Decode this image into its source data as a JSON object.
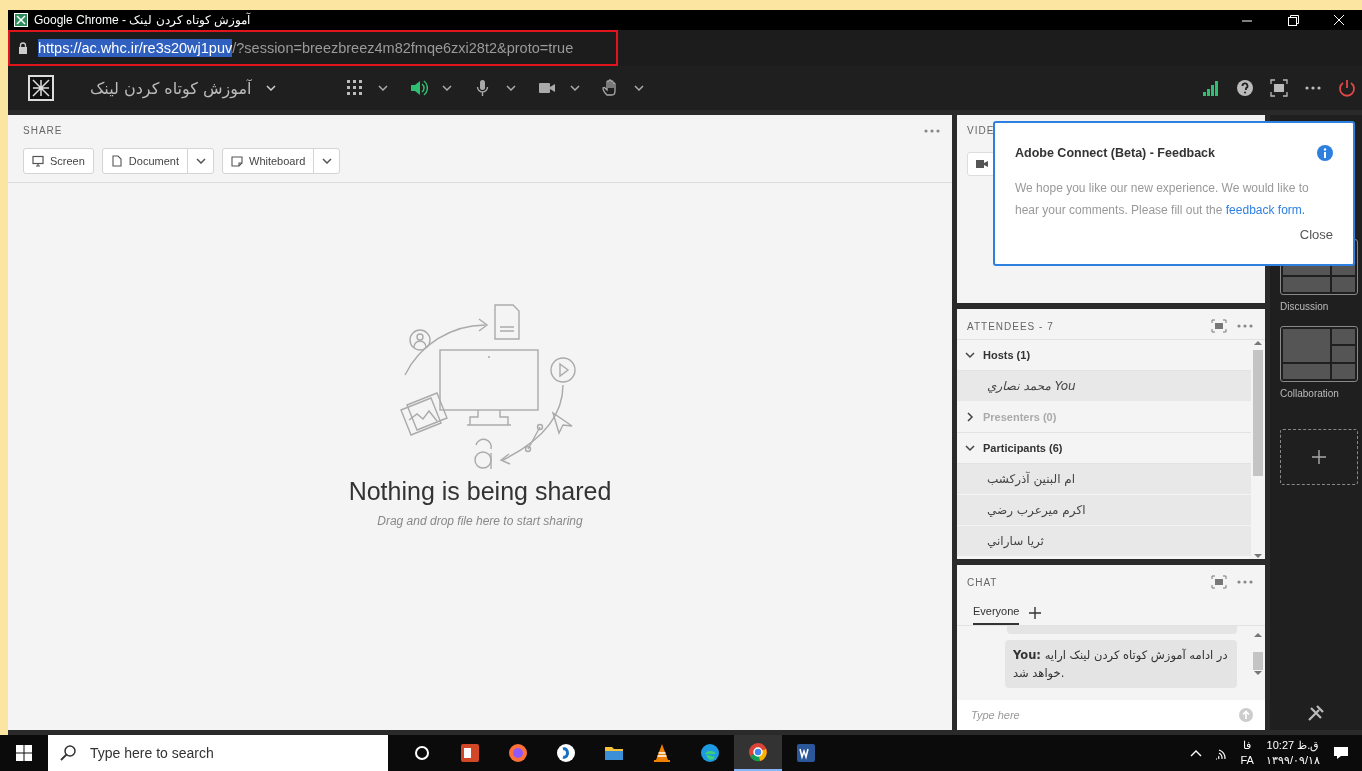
{
  "window": {
    "title": "Google Chrome - آموزش کوتاه کردن لینک"
  },
  "address": {
    "url_selected": "https://ac.whc.ir/re3s20wj1puv",
    "url_rest": "/?session=breezbreez4m82fmqe6zxi28t2&proto=true"
  },
  "toolbar": {
    "room_title": "آموزش کوتاه کردن لینک",
    "controls": [
      {
        "kind": "grid"
      },
      {
        "kind": "speaker",
        "on": true
      },
      {
        "kind": "mic",
        "on": false
      },
      {
        "kind": "camera",
        "on": false
      },
      {
        "kind": "hand"
      }
    ]
  },
  "share": {
    "title": "SHARE",
    "buttons": [
      {
        "kind": "screen",
        "label": "Screen",
        "dropdown": false
      },
      {
        "kind": "document",
        "label": "Document",
        "dropdown": true
      },
      {
        "kind": "whiteboard",
        "label": "Whiteboard",
        "dropdown": true
      }
    ],
    "empty_title": "Nothing is being shared",
    "empty_hint": "Drag and drop file here to start sharing"
  },
  "video": {
    "title": "VIDE"
  },
  "dialog": {
    "title": "Adobe Connect (Beta) - Feedback",
    "body": "We hope you like our new experience. We would like to hear your comments. Please fill out the",
    "link": "feedback form.",
    "close": "Close"
  },
  "attendees": {
    "title": "ATTENDEES  - 7",
    "groups": [
      {
        "label": "Hosts (1)",
        "expanded": true,
        "disabled": false,
        "children": [
          {
            "name": "You محمد نصاري",
            "is_you": true
          }
        ]
      },
      {
        "label": "Presenters (0)",
        "expanded": false,
        "disabled": true
      },
      {
        "label": "Participants (6)",
        "expanded": true,
        "disabled": false,
        "children": [
          {
            "name": "ام البنین آذرکشب",
            "is_you": false
          },
          {
            "name": "اکرم میرعرب رضي",
            "is_you": false
          },
          {
            "name": "ثریا ساراني",
            "is_you": false
          }
        ]
      }
    ]
  },
  "chat": {
    "title": "CHAT",
    "tabs": [
      {
        "label": "Everyone",
        "selected": true
      }
    ],
    "messages": [
      {
        "text": "**You:**  در ادامه آموزش کوتاه کردن لینک ارایه خواهد شد."
      }
    ],
    "placeholder": "Type here"
  },
  "layouts": {
    "items": [
      {
        "label": "Discussion"
      },
      {
        "label": "Collaboration"
      }
    ]
  },
  "taskbar": {
    "search_placeholder": "Type here to search",
    "apps": [
      {
        "kind": "taskview",
        "active": false
      },
      {
        "kind": "powerpoint",
        "active": false
      },
      {
        "kind": "firefox",
        "active": false
      },
      {
        "kind": "app",
        "active": false
      },
      {
        "kind": "folder",
        "active": false
      },
      {
        "kind": "vlc",
        "active": false
      },
      {
        "kind": "edge",
        "active": false
      },
      {
        "kind": "chrome",
        "active": true
      },
      {
        "kind": "word",
        "active": false
      }
    ],
    "lang_top": "فا",
    "lang_bottom": "FA",
    "time": "ق.ظ 10:27",
    "date": "۱۳۹۹/۰۹/۱۸"
  }
}
